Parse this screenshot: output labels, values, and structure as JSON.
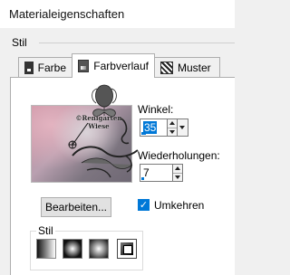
{
  "window": {
    "title": "Materialeigenschaften"
  },
  "group": {
    "label": "Stil"
  },
  "tabs": [
    {
      "label": "Farbe",
      "icon": "color-swatch-icon"
    },
    {
      "label": "Farbverlauf",
      "icon": "gradient-icon",
      "active": true
    },
    {
      "label": "Muster",
      "icon": "pattern-icon"
    }
  ],
  "watermark": {
    "line1": "©Renigarten",
    "line2": "Wiese"
  },
  "angle": {
    "label": "Winkel:",
    "value": "35"
  },
  "repeats": {
    "label": "Wiederholungen:",
    "value": "7"
  },
  "edit_button": {
    "label": "Bearbeiten..."
  },
  "invert": {
    "label": "Umkehren",
    "checked": true
  },
  "style_group": {
    "label": "Stil",
    "buttons": [
      "linear-gradient-icon",
      "rectangular-gradient-icon",
      "radial-gradient-icon",
      "sunburst-gradient-icon"
    ]
  },
  "colors": {
    "accent": "#0078d7",
    "panel": "#ffffff",
    "window": "#f0f0f0"
  }
}
